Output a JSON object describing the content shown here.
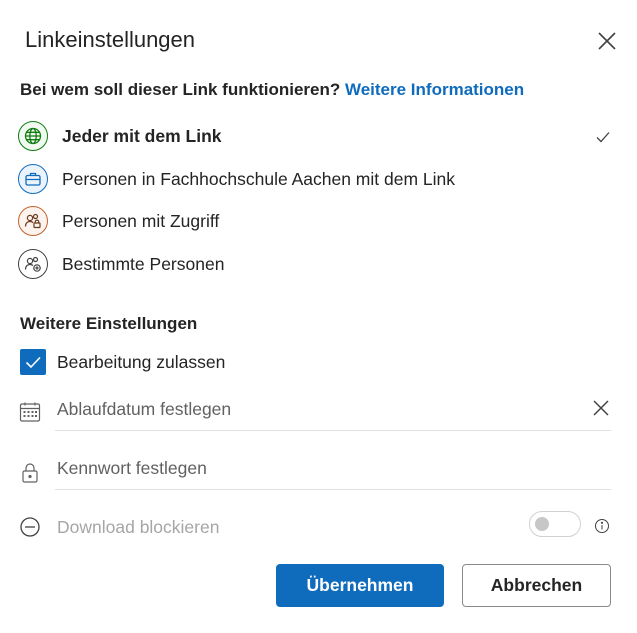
{
  "dialog": {
    "title": "Linkeinstellungen"
  },
  "audience": {
    "question": "Bei wem soll dieser Link funktionieren?",
    "more_info_link": "Weitere Informationen",
    "options": [
      {
        "label": "Jeder mit dem Link",
        "icon": "globe-icon",
        "color": "#107c10",
        "selected": true
      },
      {
        "label": "Personen in Fachhochschule Aachen mit dem Link",
        "icon": "briefcase-icon",
        "color": "#0f6cbd",
        "selected": false
      },
      {
        "label": "Personen mit Zugriff",
        "icon": "people-lock-icon",
        "color": "#c4622d",
        "selected": false
      },
      {
        "label": "Bestimmte Personen",
        "icon": "people-add-icon",
        "color": "#424242",
        "selected": false
      }
    ]
  },
  "settings": {
    "heading": "Weitere Einstellungen",
    "allow_editing": {
      "label": "Bearbeitung zulassen",
      "checked": true
    },
    "expiration": {
      "placeholder": "Ablaufdatum festlegen"
    },
    "password": {
      "placeholder": "Kennwort festlegen"
    },
    "block_download": {
      "label": "Download blockieren",
      "enabled": false
    }
  },
  "buttons": {
    "apply": "Übernehmen",
    "cancel": "Abbrechen"
  },
  "colors": {
    "accent": "#0f6cbd",
    "text": "#242424",
    "disabled_text": "#a6a6a6"
  }
}
